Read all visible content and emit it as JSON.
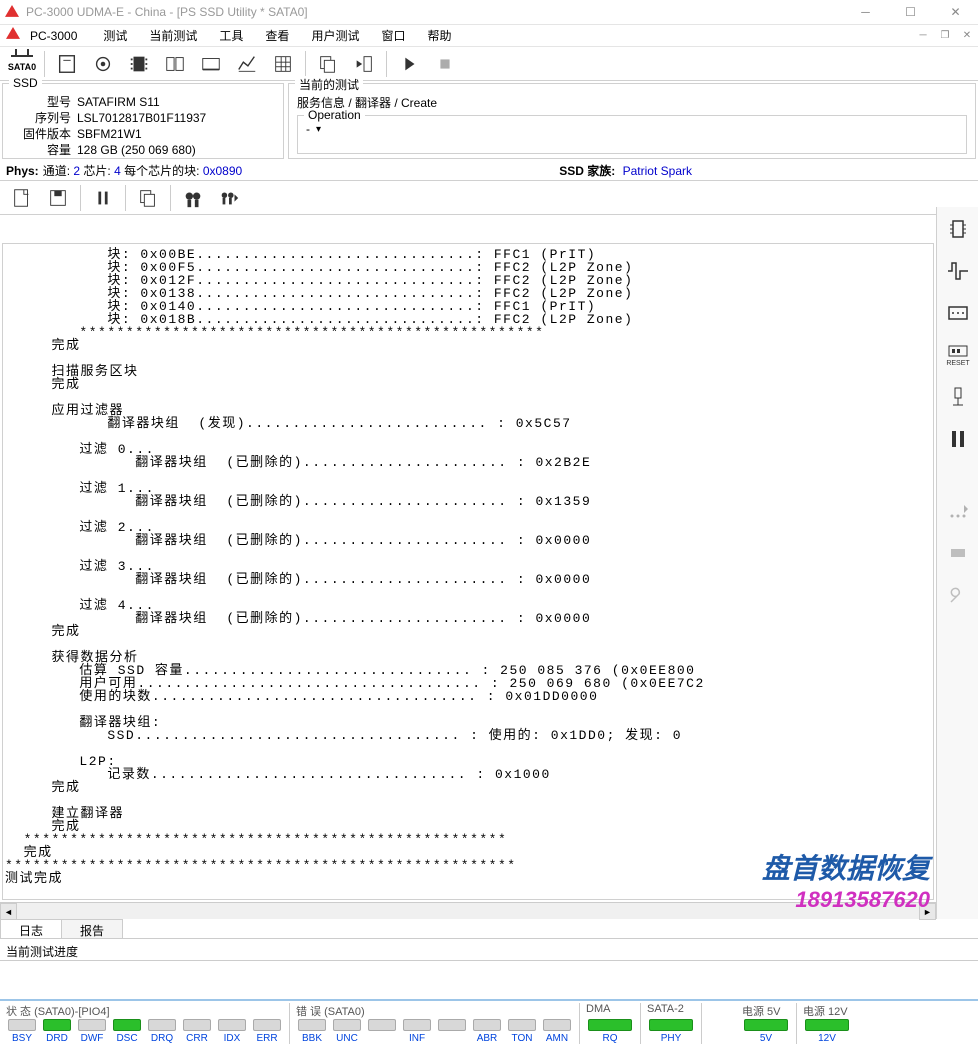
{
  "window": {
    "title": "PC-3000 UDMA-E - China - [PS SSD Utility * SATA0]",
    "title2": "PC-3000"
  },
  "menu": {
    "m0": "测试",
    "m1": "当前测试",
    "m2": "工具",
    "m3": "查看",
    "m4": "用户测试",
    "m5": "窗口",
    "m6": "帮助"
  },
  "toolbar": {
    "sata": "SATA0"
  },
  "ssd": {
    "legend": "SSD",
    "model_label": "型号",
    "model": "SATAFIRM   S11",
    "serial_label": "序列号",
    "serial": "LSL7012817B01F11937",
    "fw_label": "固件版本",
    "fw": "SBFM21W1",
    "cap_label": "容量",
    "cap": "128 GB (250 069 680)"
  },
  "curtest": {
    "legend": "当前的测试",
    "path": "服务信息 / 翻译器 / Create"
  },
  "operation": {
    "legend": "Operation",
    "value": "-"
  },
  "phys": {
    "label": "Phys:",
    "ch_l": "通道:",
    "ch": "2",
    "chip_l": "芯片:",
    "chip": "4",
    "bpc_l": "每个芯片的块:",
    "bpc": "0x0890",
    "fam_l": "SSD 家族:",
    "fam": "Patriot Spark"
  },
  "log_text": "           块: 0x00BE..............................: FFC1 (PrIT)\n           块: 0x00F5..............................: FFC2 (L2P Zone)\n           块: 0x012F..............................: FFC2 (L2P Zone)\n           块: 0x0138..............................: FFC2 (L2P Zone)\n           块: 0x0140..............................: FFC1 (PrIT)\n           块: 0x018B..............................: FFC2 (L2P Zone)\n        **************************************************\n     完成\n\n     扫描服务区块\n     完成\n\n     应用过滤器\n           翻译器块组  (发现).......................... : 0x5C57\n\n        过滤 0...\n              翻译器块组  (已删除的)...................... : 0x2B2E\n\n        过滤 1...\n              翻译器块组  (已删除的)...................... : 0x1359\n\n        过滤 2...\n              翻译器块组  (已删除的)...................... : 0x0000\n\n        过滤 3...\n              翻译器块组  (已删除的)...................... : 0x0000\n\n        过滤 4...\n              翻译器块组  (已删除的)...................... : 0x0000\n     完成\n\n     获得数据分析\n        估算 SSD 容量............................... : 250 085 376 (0x0EE800\n        用户可用..................................... : 250 069 680 (0x0EE7C2\n        使用的块数................................... : 0x01DD0000\n\n        翻译器块组:\n           SSD................................... : 使用的: 0x1DD0; 发现: 0\n\n        L2P:\n           记录数.................................. : 0x1000\n     完成\n\n     建立翻译器\n     完成\n  ****************************************************\n  完成\n*******************************************************\n测试完成",
  "tabs": {
    "t0": "日志",
    "t1": "报告"
  },
  "progress_label": "当前测试进度",
  "status": {
    "state_label": "状 态 (SATA0)-[PIO4]",
    "err_label": "错 误 (SATA0)",
    "dma_label": "DMA",
    "sata2_label": "SATA-2",
    "p5_label": "电源 5V",
    "p12_label": "电源 12V",
    "state": [
      "BSY",
      "DRD",
      "DWF",
      "DSC",
      "DRQ",
      "CRR",
      "IDX",
      "ERR"
    ],
    "state_on": [
      false,
      true,
      false,
      true,
      false,
      false,
      false,
      false
    ],
    "err": [
      "BBK",
      "UNC",
      "",
      "INF",
      "",
      "ABR",
      "TON",
      "AMN"
    ],
    "dma": "RQ",
    "sata2": "PHY",
    "p5": "5V",
    "p12": "12V"
  },
  "watermark": {
    "l1": "盘首数据恢复",
    "l2": "18913587620"
  }
}
